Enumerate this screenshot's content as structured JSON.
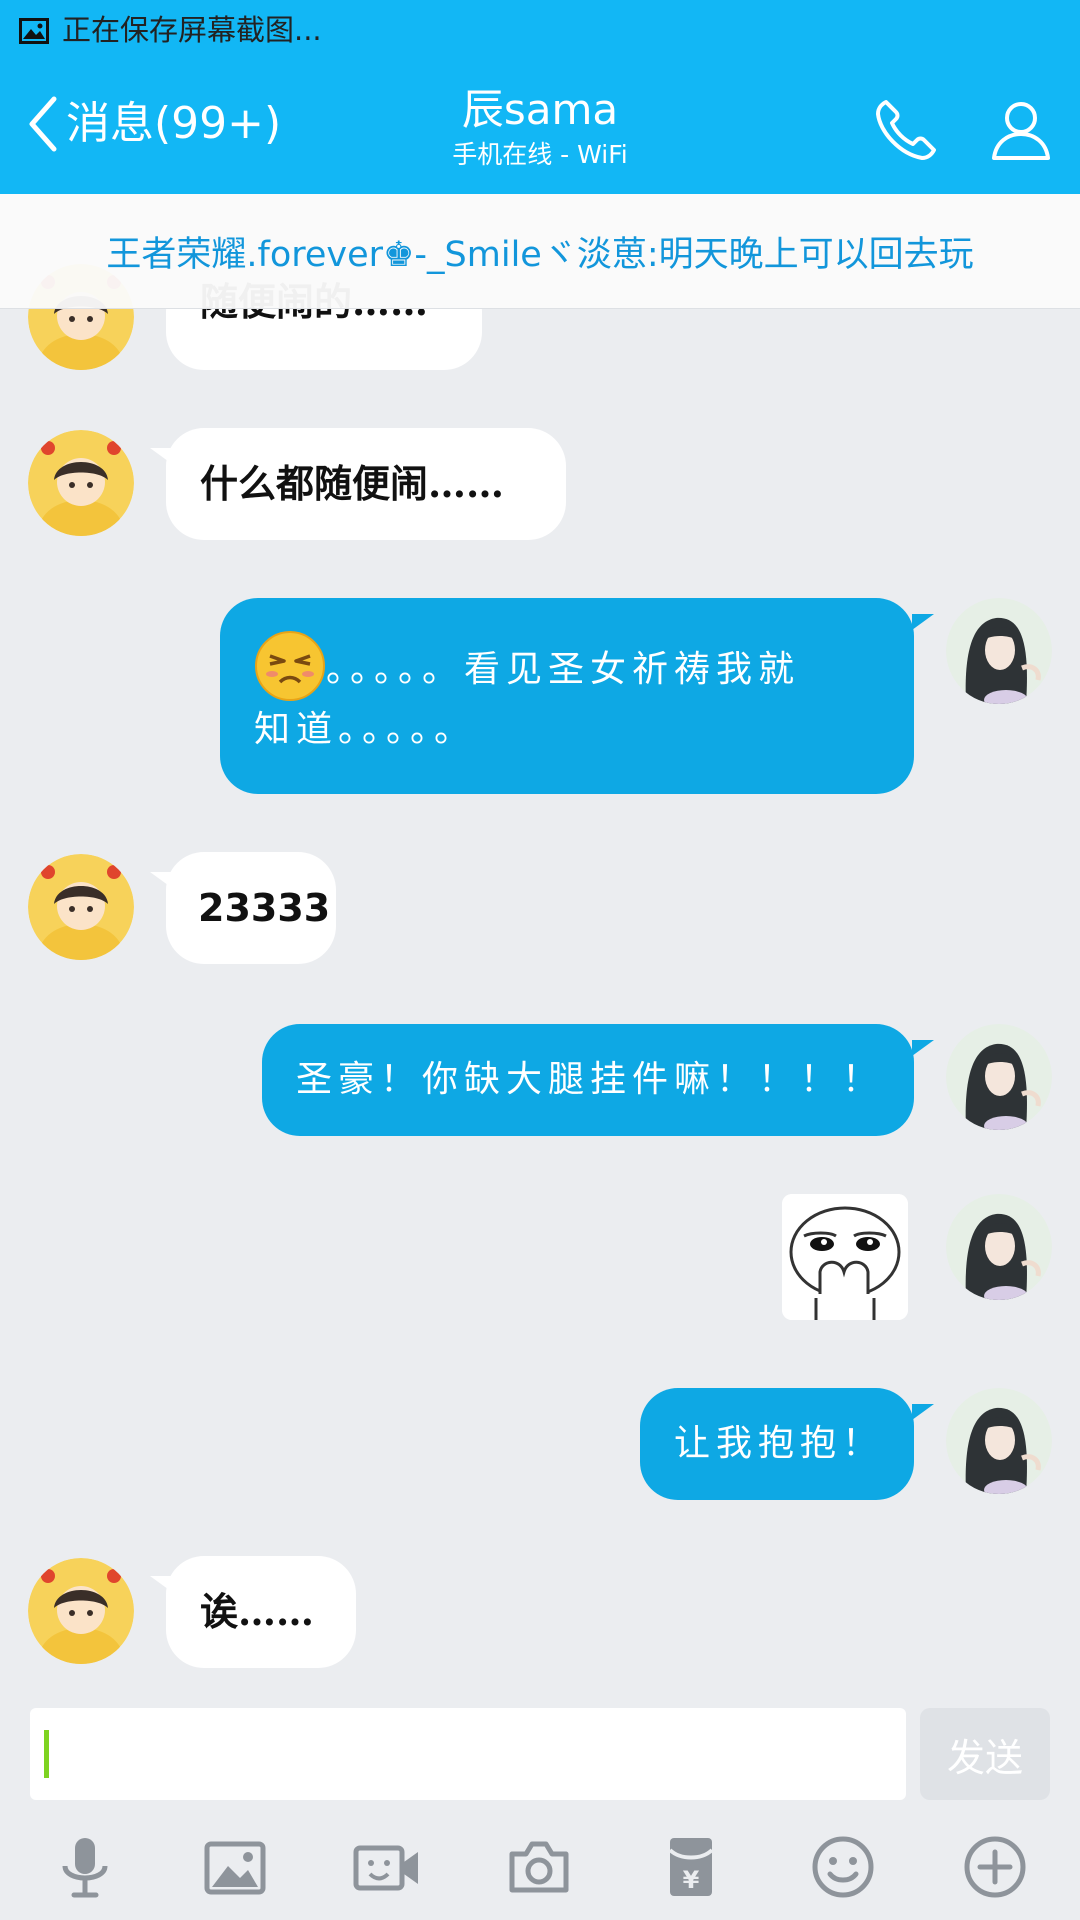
{
  "status_bar": {
    "text": "正在保存屏幕截图..."
  },
  "header": {
    "back_label": "消息(99+)",
    "title": "辰sama",
    "subtitle": "手机在线 - WiFi"
  },
  "banner": {
    "text": "王者荣耀.forever♚-_Smileヾ淡葸:明天晚上可以回去玩"
  },
  "messages": [
    {
      "side": "in",
      "text": "随便闹的……"
    },
    {
      "side": "in",
      "text": "什么都随便闹……"
    },
    {
      "side": "out",
      "emoji": "tired-face-emoji",
      "text_line1": "。。。。。看见圣女祈祷我就",
      "text_line2": "知道。。。。。"
    },
    {
      "side": "in",
      "text": "23333"
    },
    {
      "side": "out",
      "text": "圣豪！你缺大腿挂件嘛！！！！"
    },
    {
      "side": "out",
      "sticker": "shy-face-sticker"
    },
    {
      "side": "out",
      "text": "让我抱抱！"
    },
    {
      "side": "in",
      "text": "诶……"
    }
  ],
  "input": {
    "value": "",
    "send_label": "发送"
  },
  "toolbar": {
    "icons": [
      "microphone-icon",
      "image-icon",
      "video-call-icon",
      "camera-icon",
      "red-packet-icon",
      "emoji-icon",
      "plus-icon"
    ]
  },
  "colors": {
    "brand": "#12b7f5",
    "outgoing_bubble": "#0ea8e4",
    "banner_text": "#1296db",
    "background": "#ebedf0"
  }
}
